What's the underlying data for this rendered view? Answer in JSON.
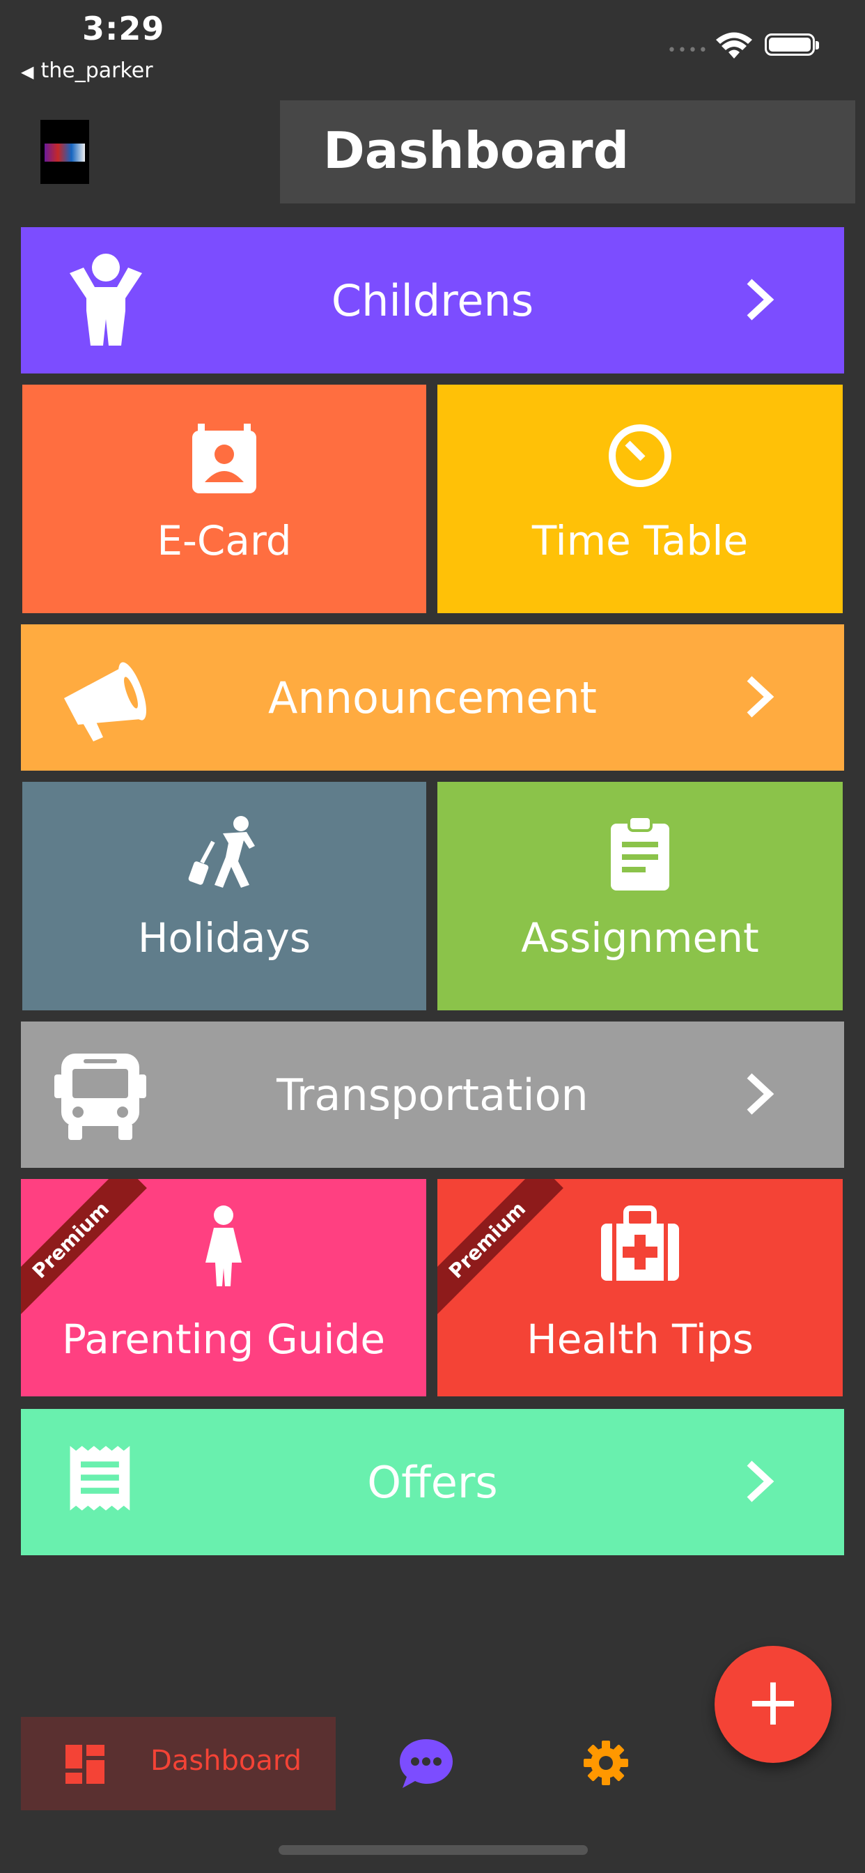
{
  "status_bar": {
    "time": "3:29",
    "back_app": "the_parker"
  },
  "header": {
    "title": "Dashboard"
  },
  "tiles": {
    "childrens": {
      "label": "Childrens",
      "color": "#7c4dff",
      "icon": "child-icon"
    },
    "ecard": {
      "label": "E-Card",
      "color": "#ff6e40",
      "icon": "contact-card-icon"
    },
    "timetable": {
      "label": "Time Table",
      "color": "#ffc107",
      "icon": "timer-icon"
    },
    "announcement": {
      "label": "Announcement",
      "color": "#ffab40",
      "icon": "megaphone-icon"
    },
    "holidays": {
      "label": "Holidays",
      "color": "#607d8b",
      "icon": "traveler-icon"
    },
    "assignment": {
      "label": "Assignment",
      "color": "#8bc34a",
      "icon": "clipboard-icon"
    },
    "transportation": {
      "label": "Transportation",
      "color": "#9e9e9e",
      "icon": "bus-icon"
    },
    "parenting": {
      "label": "Parenting Guide",
      "color": "#ff4081",
      "icon": "woman-icon",
      "badge": "Premium"
    },
    "health": {
      "label": "Health Tips",
      "color": "#f44336",
      "icon": "medical-kit-icon",
      "badge": "Premium"
    },
    "offers": {
      "label": "Offers",
      "color": "#69f0ae",
      "icon": "receipt-icon"
    }
  },
  "bottom_nav": {
    "dashboard_label": "Dashboard",
    "active_color": "#f44336",
    "chat_color": "#7c4dff",
    "settings_color": "#ff9800"
  },
  "fab": {
    "label": "+"
  }
}
